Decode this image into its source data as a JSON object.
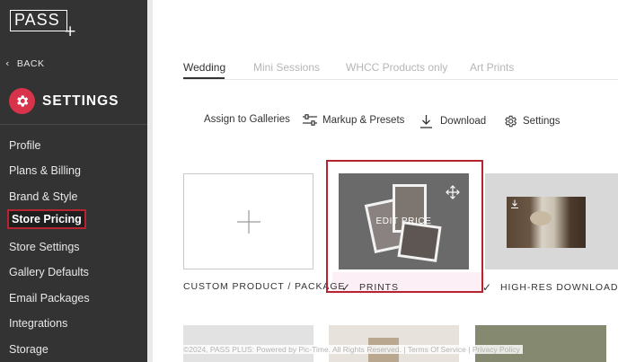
{
  "sidebar": {
    "logo_text": "PASS",
    "logo_plus": "+",
    "back_label": "BACK",
    "settings_title": "SETTINGS",
    "items": [
      {
        "label": "Profile"
      },
      {
        "label": "Plans & Billing"
      },
      {
        "label": "Brand & Style"
      },
      {
        "label": "Store Pricing",
        "active": true
      },
      {
        "label": "Store Settings"
      },
      {
        "label": "Gallery Defaults"
      },
      {
        "label": "Email Packages"
      },
      {
        "label": "Integrations"
      },
      {
        "label": "Storage"
      }
    ]
  },
  "tabs": [
    {
      "label": "Wedding",
      "active": true
    },
    {
      "label": "Mini Sessions"
    },
    {
      "label": "WHCC Products only"
    },
    {
      "label": "Art Prints"
    }
  ],
  "toolbar": {
    "assign_label": "Assign to Galleries",
    "markup_label": "Markup & Presets",
    "download_label": "Download",
    "settings_label": "Settings"
  },
  "products": {
    "custom_label": "CUSTOM PRODUCT / PACKAGE",
    "prints_label": "PRINTS",
    "prints_overlay": "EDIT PRICE",
    "hires_label": "HIGH-RES DOWNLOADS",
    "check_glyph": "✓"
  },
  "footer": {
    "text": "©2024, PASS PLUS: Powered by Pic-Time. All Rights Reserved. | Terms Of Service | Privacy Policy"
  },
  "colors": {
    "sidebar_bg": "#333333",
    "accent_red": "#d9334b",
    "highlight_red": "#b5242f"
  },
  "icons": {
    "back": "chevron-left-icon",
    "settings_badge": "gear-icon",
    "markup": "sliders-icon",
    "download": "download-icon",
    "settings": "gear-outline-icon",
    "add": "plus-icon",
    "move": "move-arrows-icon",
    "check": "check-icon"
  }
}
